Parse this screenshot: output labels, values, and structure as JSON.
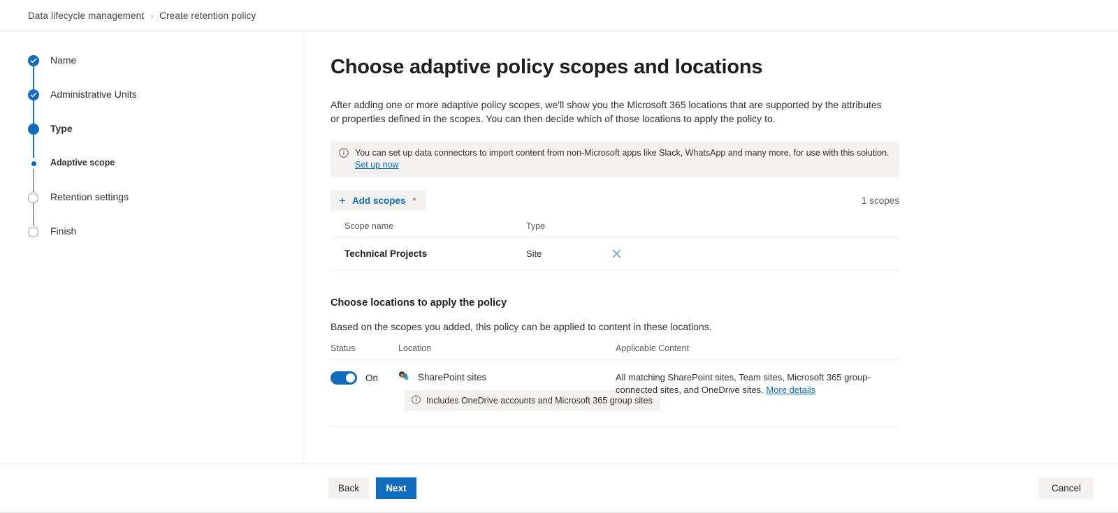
{
  "breadcrumb": {
    "parent": "Data lifecycle management",
    "separator": "›",
    "current": "Create retention policy"
  },
  "wizard": {
    "steps": [
      {
        "label": "Name",
        "state": "completed"
      },
      {
        "label": "Administrative Units",
        "state": "completed"
      },
      {
        "label": "Type",
        "state": "current"
      },
      {
        "label": "Adaptive scope",
        "state": "substep"
      },
      {
        "label": "Retention settings",
        "state": "upcoming"
      },
      {
        "label": "Finish",
        "state": "upcoming"
      }
    ]
  },
  "main": {
    "title": "Choose adaptive policy scopes and locations",
    "description": "After adding one or more adaptive policy scopes, we'll show you the Microsoft 365 locations that are supported by the attributes or properties defined in the scopes. You can then decide which of those locations to apply the policy to.",
    "info_banner": {
      "icon": "info-icon",
      "text": "You can set up data connectors to import content from non-Microsoft apps like Slack, WhatsApp and many more, for use with this solution.",
      "link_text": "Set up now"
    },
    "scopes": {
      "add_button_label": "Add scopes",
      "add_button_icon": "plus-icon",
      "required_marker": "*",
      "count_label": "1 scopes",
      "columns": [
        "Scope name",
        "Type"
      ],
      "rows": [
        {
          "name": "Technical Projects",
          "type": "Site",
          "remove_icon": "close-icon"
        }
      ]
    },
    "locations": {
      "title": "Choose locations to apply the policy",
      "subtitle": "Based on the scopes you added, this policy can be applied to content in these locations.",
      "columns": [
        "Status",
        "Location",
        "Applicable Content"
      ],
      "rows": [
        {
          "toggle_state": "On",
          "toggle_on": true,
          "location_icon": "sharepoint-icon",
          "location": "SharePoint sites",
          "note_icon": "info-icon",
          "note": "Includes OneDrive accounts and Microsoft 365 group sites",
          "applicable_content": "All matching SharePoint sites, Team sites, Microsoft 365 group-connected sites, and OneDrive sites.",
          "applicable_link": "More details"
        }
      ]
    }
  },
  "footer": {
    "back_label": "Back",
    "next_label": "Next",
    "cancel_label": "Cancel"
  },
  "colors": {
    "accent": "#0f6cbd",
    "required": "#d13438",
    "surface": "#f3f2f1",
    "border": "#edebe9"
  }
}
